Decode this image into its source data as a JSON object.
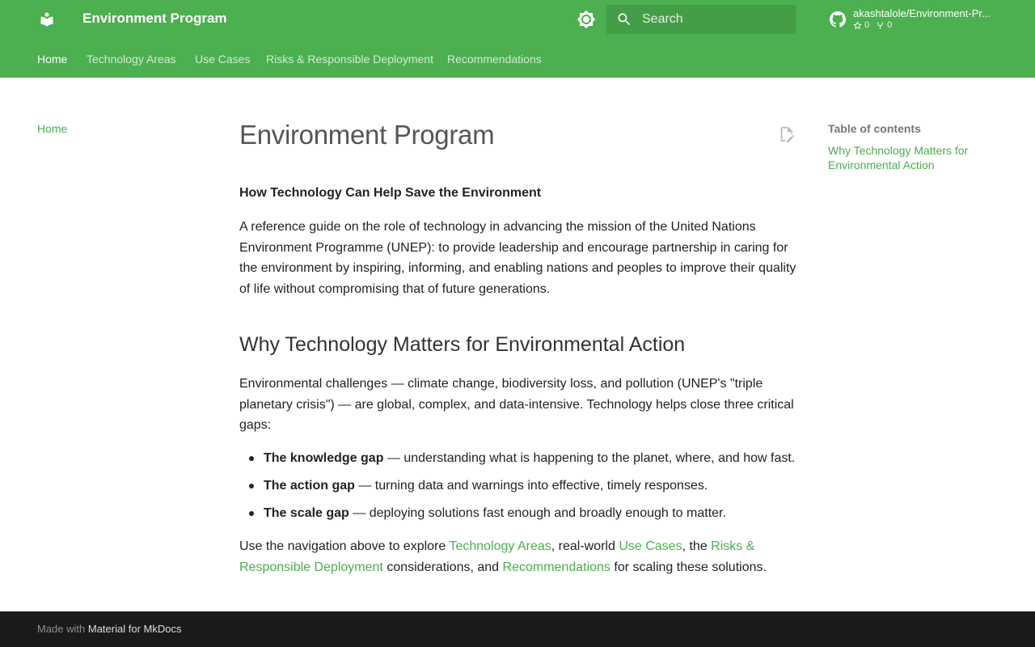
{
  "header": {
    "site_title": "Environment Program",
    "logo_icon": "book-icon",
    "theme_icon": "brightness-icon",
    "search_placeholder": "Search",
    "repo": {
      "name": "akashtalole/Environment-Pr...",
      "stars": "0",
      "forks": "0"
    }
  },
  "tabs": [
    {
      "label": "Home",
      "active": true
    },
    {
      "label": "Technology Areas",
      "active": false
    },
    {
      "label": "Use Cases",
      "active": false
    },
    {
      "label": "Risks & Responsible Deployment",
      "active": false
    },
    {
      "label": "Recommendations",
      "active": false
    }
  ],
  "sidebar": {
    "items": [
      {
        "label": "Home"
      }
    ]
  },
  "main": {
    "title": "Environment Program",
    "subtitle": "How Technology Can Help Save the Environment",
    "intro": "A reference guide on the role of technology in advancing the mission of the United Nations Environment Programme (UNEP): to provide leadership and encourage partnership in caring for the environment by inspiring, informing, and enabling nations and peoples to improve their quality of life without compromising that of future generations.",
    "section_heading": "Why Technology Matters for Environmental Action",
    "section_intro": "Environmental challenges — climate change, biodiversity loss, and pollution (UNEP's \"triple planetary crisis\") — are global, complex, and data-intensive. Technology helps close three critical gaps:",
    "gaps": [
      {
        "term": "The knowledge gap",
        "desc": " — understanding what is happening to the planet, where, and how fast."
      },
      {
        "term": "The action gap",
        "desc": " — turning data and warnings into effective, timely responses."
      },
      {
        "term": "The scale gap",
        "desc": " — deploying solutions fast enough and broadly enough to matter."
      }
    ],
    "closing": {
      "t1": "Use the navigation above to explore ",
      "link1": "Technology Areas",
      "t2": ", real-world ",
      "link2": "Use Cases",
      "t3": ", the ",
      "link3": "Risks & Responsible Deployment",
      "t4": " considerations, and ",
      "link4": "Recommendations",
      "t5": " for scaling these solutions."
    }
  },
  "toc": {
    "title": "Table of contents",
    "items": [
      {
        "label": "Why Technology Matters for Environmental Action"
      }
    ]
  },
  "footer": {
    "prefix": "Made with ",
    "link": "Material for MkDocs"
  },
  "colors": {
    "primary": "#4caf50",
    "link": "#4cae4f",
    "footer_bg": "#1a1a1a"
  }
}
